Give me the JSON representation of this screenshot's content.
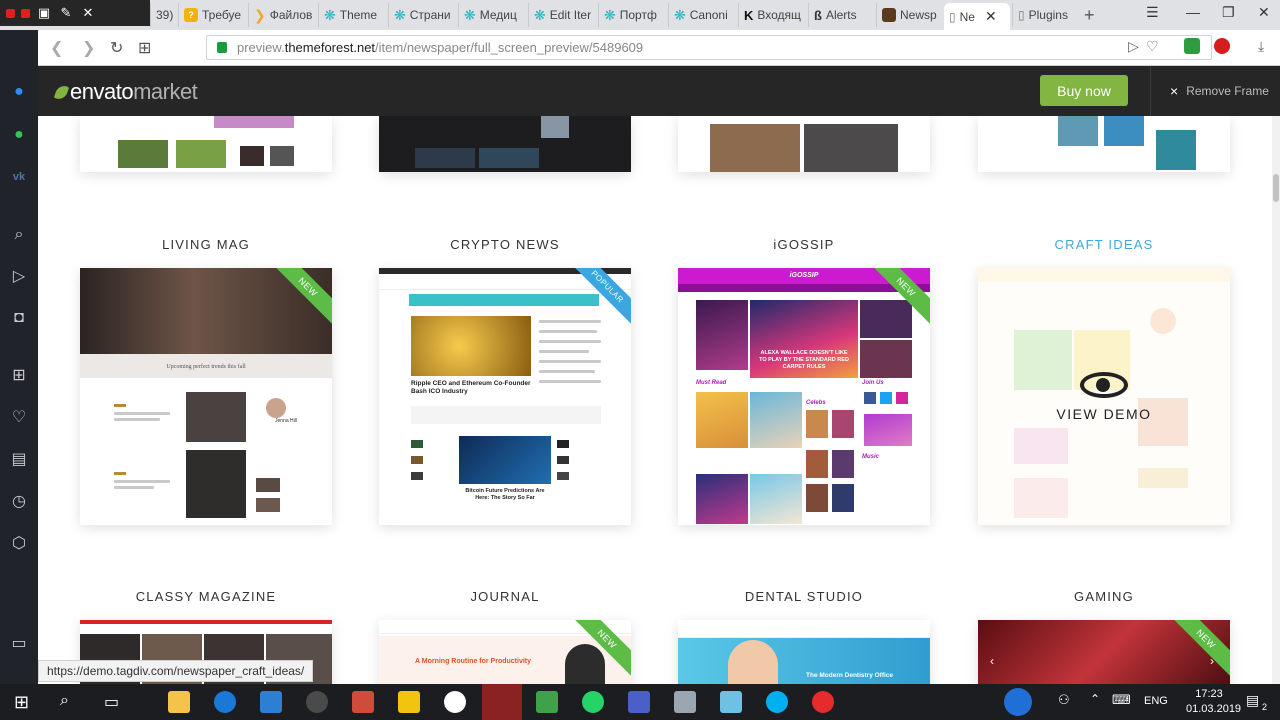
{
  "browser": {
    "tabs": [
      {
        "label": "39)",
        "color": "#c62828"
      },
      {
        "label": "Требуе",
        "color": "#f2b400"
      },
      {
        "label": "Файлов",
        "color": "#f5a623"
      },
      {
        "label": "Theme",
        "color": "#2ab4c0"
      },
      {
        "label": "Страни",
        "color": "#2ab4c0"
      },
      {
        "label": "Медиц",
        "color": "#2ab4c0"
      },
      {
        "label": "Edit Iter",
        "color": "#2ab4c0"
      },
      {
        "label": "Портф",
        "color": "#2ab4c0"
      },
      {
        "label": "Canoni",
        "color": "#2ab4c0"
      },
      {
        "label": "Входящ",
        "color": "#111111"
      },
      {
        "label": "Alerts",
        "color": "#333333"
      },
      {
        "label": "Newsp",
        "color": "#5b3a1e"
      },
      {
        "label": "Ne",
        "color": "#777777"
      },
      {
        "label": "Plugins",
        "color": "#777777"
      }
    ],
    "new_tab": "+",
    "url_prefix": "preview.",
    "url_host": "themeforest.net",
    "url_path": "/item/newspaper/full_screen_preview/5489609"
  },
  "header": {
    "logo_part1": "envato",
    "logo_part2": "market",
    "buy_now": "Buy now",
    "remove_frame": "Remove Frame",
    "close_x": "×"
  },
  "demos": [
    {
      "name": "LIVING MAG",
      "ribbon": "NEW",
      "ribbon_color": "#5cbc46"
    },
    {
      "name": "CRYPTO NEWS",
      "ribbon": "POPULAR",
      "ribbon_color": "#3aa7e0"
    },
    {
      "name": "iGOSSIP",
      "ribbon": "NEW",
      "ribbon_color": "#5cbc46"
    },
    {
      "name": "CRAFT IDEAS",
      "ribbon": "",
      "ribbon_color": ""
    },
    {
      "name": "CLASSY MAGAZINE",
      "ribbon": "",
      "ribbon_color": ""
    },
    {
      "name": "JOURNAL",
      "ribbon": "NEW",
      "ribbon_color": "#5cbc46"
    },
    {
      "name": "DENTAL STUDIO",
      "ribbon": "",
      "ribbon_color": ""
    },
    {
      "name": "GAMING",
      "ribbon": "NEW",
      "ribbon_color": "#5cbc46"
    }
  ],
  "thumb_text": {
    "crypto_headline": "Ripple CEO and Ethereum Co-Founder Bash ICO Industry",
    "crypto_headline2": "Bitcoin Future Predictions Are Here: The Story So Far",
    "gossip_headline": "ALEXA WALLACE DOESN'T LIKE TO PLAY BY THE STANDARD RED CARPET RULES",
    "gossip_brand": "iGOSSIP",
    "gossip_section": "Must Read",
    "gossip_join": "Join Us",
    "gossip_celebs": "Celebs",
    "gossip_music": "Music",
    "journal_headline": "A Morning Routine for Productivity",
    "dental_headline": "The Modern Dentistry Office",
    "living_headline": "Upcoming perfect trends this fall",
    "living_name": "Jenna Hill"
  },
  "overlay_label": "VIEW DEMO",
  "status_url": "https://demo.tagdiv.com/newspaper_craft_ideas/",
  "tray": {
    "lang": "ENG",
    "time": "17:23",
    "date": "01.03.2019",
    "notifications": "2"
  },
  "colors": {
    "envato_green": "#82b541",
    "header_bg": "#262626",
    "highlight_label": "#3fa9d8"
  }
}
